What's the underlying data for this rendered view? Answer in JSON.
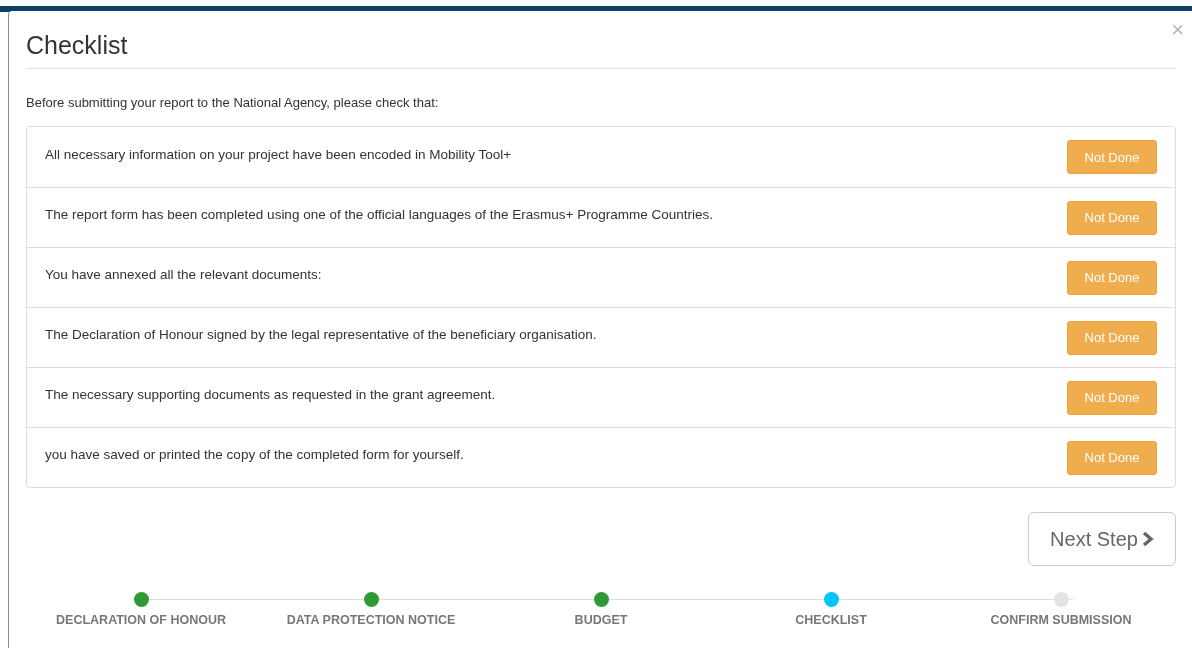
{
  "dialog": {
    "title": "Checklist",
    "close": "×",
    "intro": "Before submitting your report to the National Agency, please check that:"
  },
  "items": [
    {
      "text": "All necessary information on your project have been encoded in Mobility Tool+",
      "button": "Not Done",
      "done": false
    },
    {
      "text": "The report form has been completed using one of the official languages of the Erasmus+ Programme Countries.",
      "button": "Not Done",
      "done": false
    },
    {
      "text": "You have annexed all the relevant documents:",
      "button": "Not Done",
      "done": false
    },
    {
      "text": "The Declaration of Honour signed by the legal representative of the beneficiary organisation.",
      "button": "Not Done",
      "done": false
    },
    {
      "text": "The necessary supporting documents as requested in the grant agreement.",
      "button": "Not Done",
      "done": false
    },
    {
      "text": "you have saved or printed the copy of the completed form for yourself.",
      "button": "Not Done",
      "done": false
    }
  ],
  "next_button": "Next Step",
  "steps": [
    {
      "label": "DECLARATION OF HONOUR",
      "kind": "done"
    },
    {
      "label": "DATA PROTECTION NOTICE",
      "kind": "done"
    },
    {
      "label": "BUDGET",
      "kind": "done"
    },
    {
      "label": "CHECKLIST",
      "kind": "current"
    },
    {
      "label": "CONFIRM SUBMISSION",
      "kind": "todo"
    }
  ]
}
